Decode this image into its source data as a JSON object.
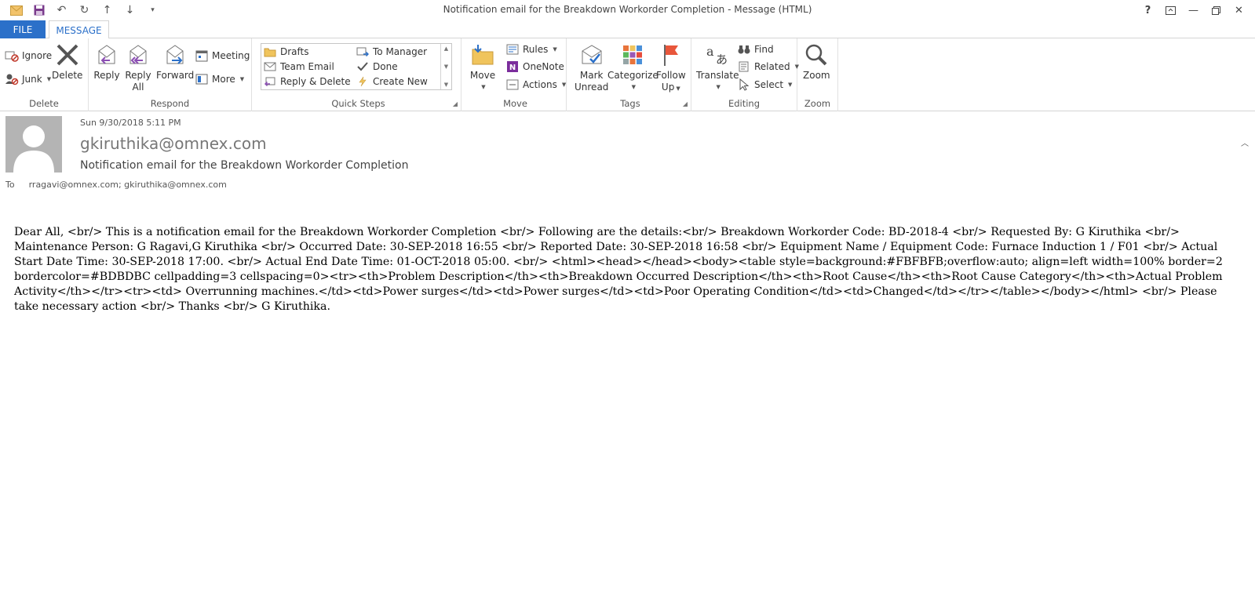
{
  "window": {
    "title": "Notification email for the Breakdown Workorder Completion - Message (HTML)",
    "help": "?"
  },
  "tabs": {
    "file": "FILE",
    "message": "MESSAGE"
  },
  "ribbon": {
    "delete_group": {
      "label": "Delete",
      "ignore": "Ignore",
      "junk": "Junk",
      "delete": "Delete"
    },
    "respond_group": {
      "label": "Respond",
      "reply": "Reply",
      "reply_all_1": "Reply",
      "reply_all_2": "All",
      "forward": "Forward",
      "meeting": "Meeting",
      "more": "More"
    },
    "quicksteps_group": {
      "label": "Quick Steps",
      "items": [
        "Drafts",
        "To Manager",
        "Team Email",
        "Done",
        "Reply & Delete",
        "Create New"
      ]
    },
    "move_group": {
      "label": "Move",
      "move": "Move",
      "rules": "Rules",
      "onenote": "OneNote",
      "actions": "Actions"
    },
    "tags_group": {
      "label": "Tags",
      "mark_unread_1": "Mark",
      "mark_unread_2": "Unread",
      "categorize": "Categorize",
      "follow_up_1": "Follow",
      "follow_up_2": "Up"
    },
    "editing_group": {
      "label": "Editing",
      "translate": "Translate",
      "find": "Find",
      "related": "Related",
      "select": "Select"
    },
    "zoom_group": {
      "label": "Zoom",
      "zoom": "Zoom"
    }
  },
  "message": {
    "date": "Sun 9/30/2018 5:11 PM",
    "sender": "gkiruthika@omnex.com",
    "subject": "Notification email for the Breakdown Workorder Completion",
    "to_label": "To",
    "to": "rragavi@omnex.com; gkiruthika@omnex.com",
    "body": "Dear All, <br/> This is a notification email for the Breakdown Workorder Completion <br/> Following are the details:<br/> Breakdown Workorder Code: BD-2018-4 <br/> Requested By: G Kiruthika <br/> Maintenance Person: G Ragavi,G Kiruthika <br/> Occurred Date: 30-SEP-2018 16:55 <br/> Reported Date: 30-SEP-2018 16:58 <br/> Equipment Name / Equipment Code: Furnace Induction 1 / F01 <br/> Actual Start Date Time: 30-SEP-2018 17:00. <br/> Actual End Date Time: 01-OCT-2018 05:00. <br/> <html><head></head><body><table style=background:#FBFBFB;overflow:auto; align=left width=100% border=2 bordercolor=#BDBDBC cellpadding=3 cellspacing=0><tr><th>Problem Description</th><th>Breakdown Occurred Description</th><th>Root Cause</th><th>Root Cause Category</th><th>Actual Problem Activity</th></tr><tr><td> Overrunning machines.</td><td>Power surges</td><td>Power surges</td><td>Poor Operating Condition</td><td>Changed</td></tr></table></body></html> <br/> Please take necessary action <br/> Thanks <br/> G Kiruthika."
  },
  "colors": {
    "accent": "#2b70c9"
  }
}
